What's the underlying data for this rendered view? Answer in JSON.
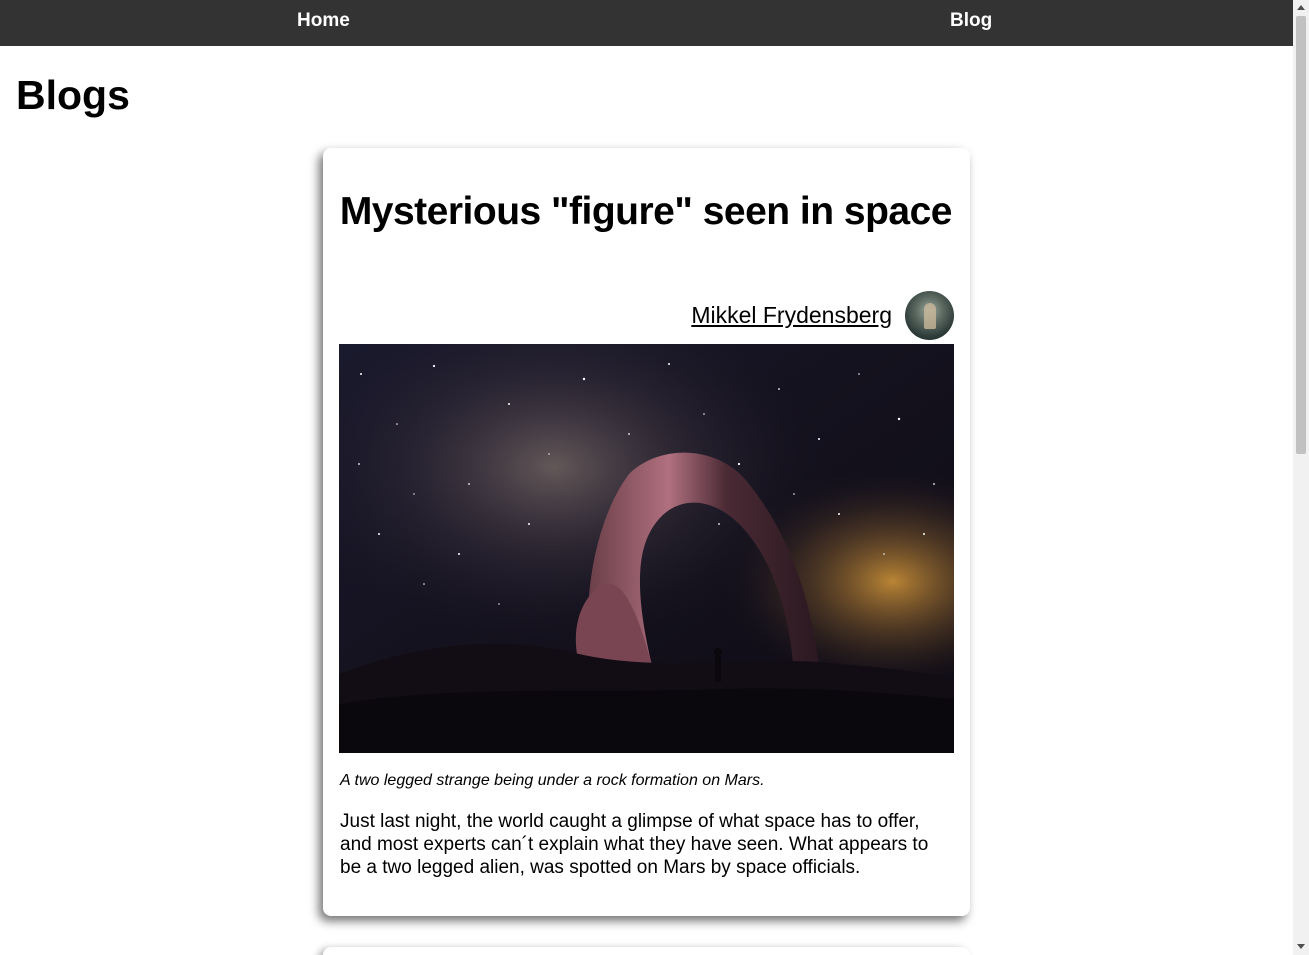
{
  "nav": {
    "home_label": "Home",
    "blog_label": "Blog"
  },
  "page": {
    "title": "Blogs"
  },
  "post": {
    "title": "Mysterious \"figure\" seen in space",
    "author": "Mikkel Frydensberg",
    "image_caption": "A two legged strange being under a rock formation on Mars.",
    "body": "Just last night, the world caught a glimpse of what space has to offer, and most experts can´t explain what they have seen. What appears to be a two legged alien, was spotted on Mars by space officials."
  },
  "colors": {
    "nav_background": "#333333",
    "nav_text": "#ffffff",
    "page_background": "#ffffff"
  }
}
